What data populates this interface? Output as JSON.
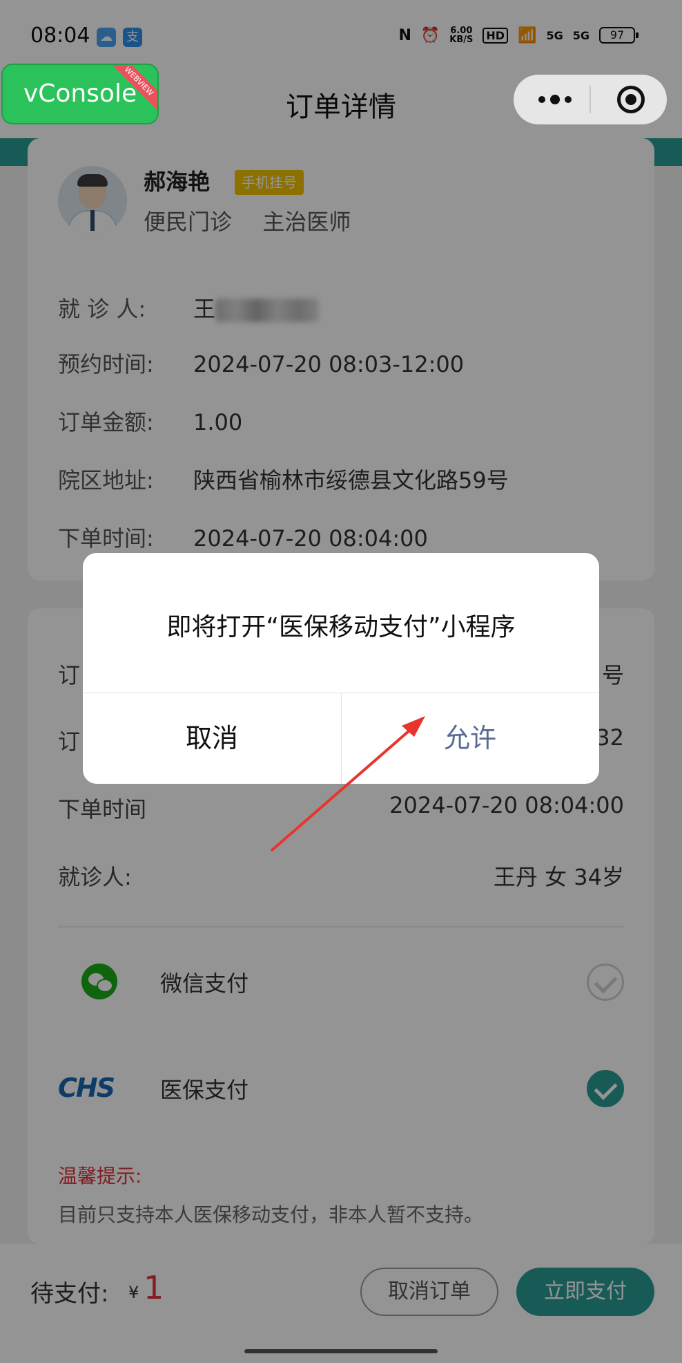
{
  "status_bar": {
    "time": "08:04",
    "app_icons": [
      "weather-icon",
      "alipay-icon"
    ],
    "alipay_glyph": "支",
    "net_speed": "6.00\nKB/S",
    "signal_text": "5G",
    "hd_text": "HD",
    "battery": "97"
  },
  "nav": {
    "title": "订单详情",
    "vconsole_label": "vConsole",
    "vconsole_ribbon": "WEBVIEW"
  },
  "doctor": {
    "name": "郝海艳",
    "tag": "手机挂号",
    "department": "便民门诊",
    "title": "主治医师"
  },
  "appointment": {
    "patient_label": "就 诊 人:",
    "patient_value_visible": "王",
    "time_label": "预约时间:",
    "time_value": "2024-07-20 08:03-12:00",
    "amount_label": "订单金额:",
    "amount_value": "1.00",
    "address_label": "院区地址:",
    "address_value": "陕西省榆林市绥德县文化路59号",
    "order_time_label": "下单时间:",
    "order_time_value": "2024-07-20 08:04:00"
  },
  "order": {
    "row1_label": "订",
    "row1_value": "号",
    "row2_label": "订",
    "row2_value": "32",
    "order_time_label": "下单时间",
    "order_time_value": "2024-07-20 08:04:00",
    "patient_label": "就诊人:",
    "patient_value": "王丹 女 34岁"
  },
  "payment": {
    "wechat_label": "微信支付",
    "chs_logo": "CHS",
    "medical_label": "医保支付",
    "selected": "医保支付"
  },
  "tip": {
    "title": "温馨提示:",
    "text": "目前只支持本人医保移动支付，非本人暂不支持。"
  },
  "bottom": {
    "due_label": "待支付:",
    "currency": "¥",
    "amount": "1",
    "cancel_order": "取消订单",
    "pay_now": "立即支付"
  },
  "dialog": {
    "message": "即将打开“医保移动支付”小程序",
    "cancel": "取消",
    "allow": "允许"
  },
  "colors": {
    "accent": "#2a9d94",
    "price": "#e0333e",
    "dialog_allow": "#576b95",
    "vconsole": "#2cc25b",
    "annotation_arrow": "#e8342c"
  }
}
